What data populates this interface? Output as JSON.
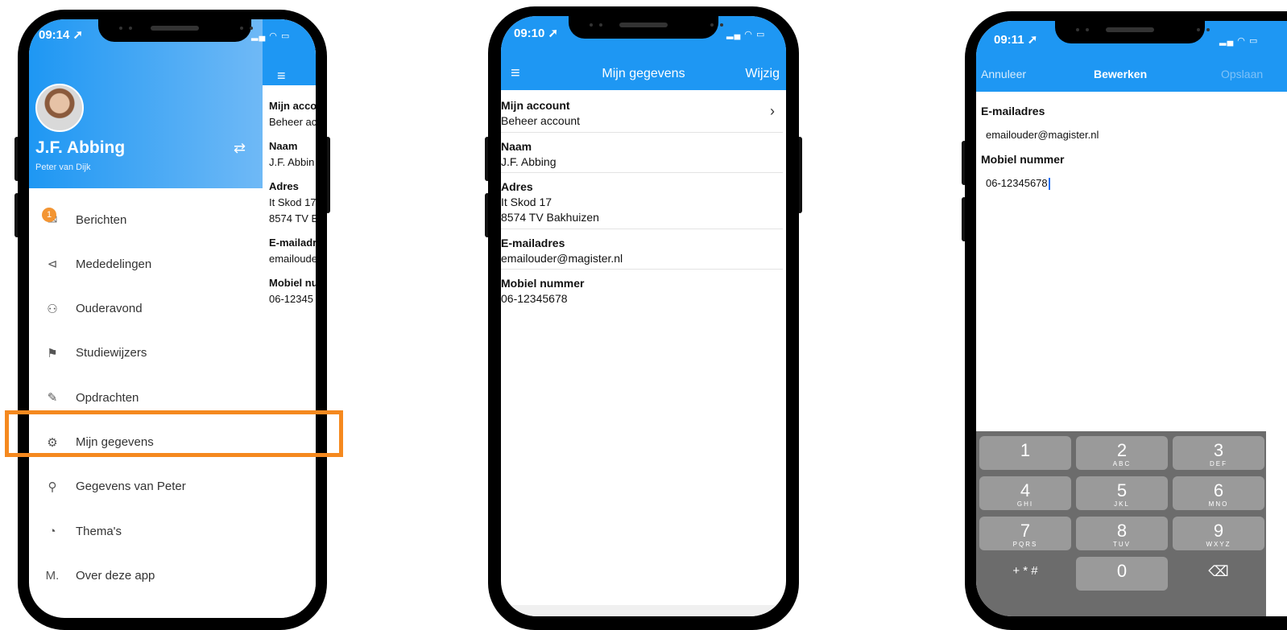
{
  "phone1": {
    "time": "09:14",
    "user_name": "J.F. Abbing",
    "user_sub": "Peter van Dijk",
    "menu": [
      {
        "label": "Berichten",
        "icon": "envelope-icon",
        "glyph": "✉",
        "badge": "1"
      },
      {
        "label": "Mededelingen",
        "icon": "megaphone-icon",
        "glyph": "⊲"
      },
      {
        "label": "Ouderavond",
        "icon": "person-clock-icon",
        "glyph": "⚇"
      },
      {
        "label": "Studiewijzers",
        "icon": "signpost-icon",
        "glyph": "⚑"
      },
      {
        "label": "Opdrachten",
        "icon": "pencil-icon",
        "glyph": "✎"
      },
      {
        "label": "Mijn gegevens",
        "icon": "gear-icon",
        "glyph": "⚙"
      },
      {
        "label": "Gegevens van Peter",
        "icon": "person-icon",
        "glyph": "⚲"
      },
      {
        "label": "Thema's",
        "icon": "palette-icon",
        "glyph": "◔"
      },
      {
        "label": "Over deze app",
        "icon": "magister-logo-icon",
        "glyph": "M."
      }
    ],
    "peek": {
      "account_label": "Mijn acco",
      "account_value": "Beheer ac",
      "name_label": "Naam",
      "name_value": "J.F. Abbin",
      "address_label": "Adres",
      "address_line1": "It Skod 17",
      "address_line2": "8574 TV B",
      "email_label": "E-mailadr",
      "email_value": "emailoude",
      "mobile_label": "Mobiel nu",
      "mobile_value": "06-12345"
    }
  },
  "phone2": {
    "time": "09:10",
    "title": "Mijn gegevens",
    "edit_label": "Wijzig",
    "account_label": "Mijn account",
    "account_value": "Beheer account",
    "name_label": "Naam",
    "name_value": "J.F. Abbing",
    "address_label": "Adres",
    "address_line1": "It Skod 17",
    "address_line2": "8574 TV Bakhuizen",
    "email_label": "E-mailadres",
    "email_value": "emailouder@magister.nl",
    "mobile_label": "Mobiel nummer",
    "mobile_value": "06-12345678"
  },
  "phone3": {
    "time": "09:11",
    "cancel_label": "Annuleer",
    "title": "Bewerken",
    "save_label": "Opslaan",
    "email_label": "E-mailadres",
    "email_value": "emailouder@magister.nl",
    "mobile_label": "Mobiel nummer",
    "mobile_value": "06-12345678",
    "keys": [
      {
        "n": "1",
        "s": ""
      },
      {
        "n": "2",
        "s": "ABC"
      },
      {
        "n": "3",
        "s": "DEF"
      },
      {
        "n": "4",
        "s": "GHI"
      },
      {
        "n": "5",
        "s": "JKL"
      },
      {
        "n": "6",
        "s": "MNO"
      },
      {
        "n": "7",
        "s": "PQRS"
      },
      {
        "n": "8",
        "s": "TUV"
      },
      {
        "n": "9",
        "s": "WXYZ"
      },
      {
        "n": "+ * #",
        "s": ""
      },
      {
        "n": "0",
        "s": ""
      },
      {
        "n": "⌫",
        "s": ""
      }
    ]
  }
}
